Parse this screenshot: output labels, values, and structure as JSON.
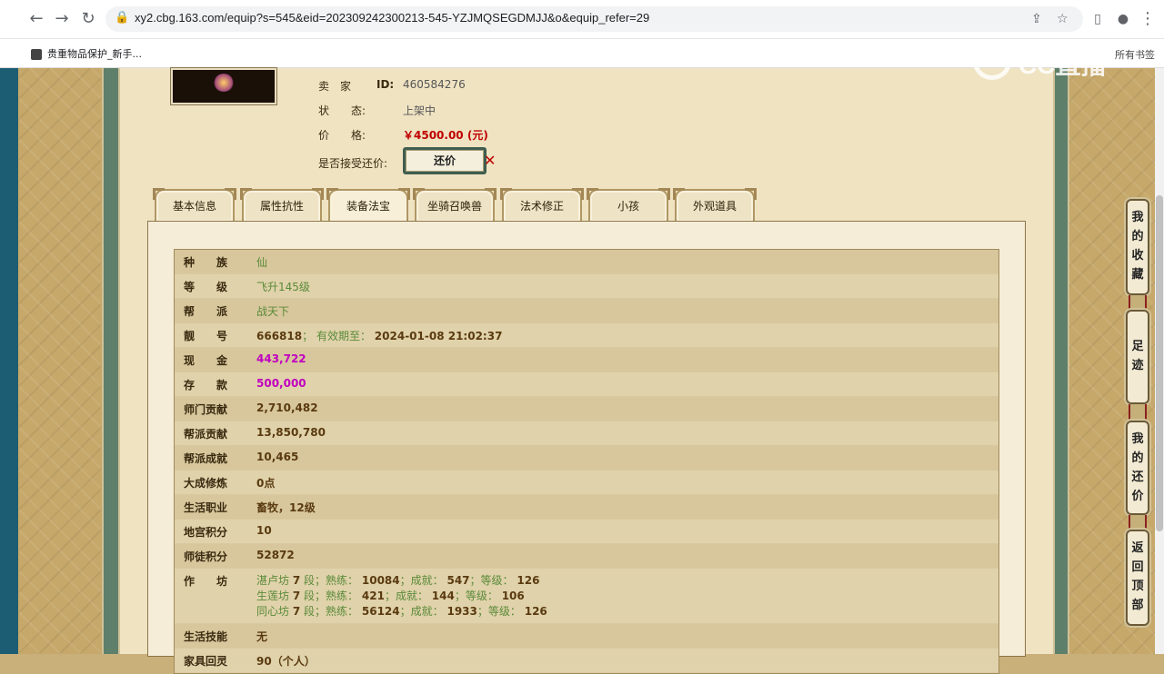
{
  "browser": {
    "url": "xy2.cbg.163.com/equip?s=545&eid=202309242300213-545-YZJMQSEGDMJJ&o&equip_refer=29",
    "bookmark": "贵重物品保护_新手...",
    "bookmarks_right": "所有书签",
    "watermark": "CC直播"
  },
  "listing": {
    "seller_label": "卖　家",
    "seller_key": "ID:",
    "seller_id": "460584276",
    "status_label": "状　　态:",
    "status_value": "上架中",
    "price_label": "价　　格:",
    "price_value": "￥4500.00 (元)",
    "counter_label": "是否接受还价:",
    "counter_button": "还价"
  },
  "tabs": [
    {
      "label": "基本信息"
    },
    {
      "label": "属性抗性"
    },
    {
      "label": "装备法宝"
    },
    {
      "label": "坐骑召唤兽"
    },
    {
      "label": "法术修正"
    },
    {
      "label": "小孩"
    },
    {
      "label": "外观道具"
    }
  ],
  "details": {
    "race_label": "种　　族",
    "race": "仙",
    "level_label": "等　　级",
    "level": "飞升145级",
    "faction_label": "帮　　派",
    "faction": "战天下",
    "number_label": "靓　　号",
    "number": "666818",
    "number_sep": "；",
    "valid_label": "有效期至：",
    "valid_date": "2024-01-08 21:02:37",
    "cash_label": "现　　金",
    "cash": "443,722",
    "deposit_label": "存　　款",
    "deposit": "500,000",
    "sect_contrib_label": "师门贡献",
    "sect_contrib": "2,710,482",
    "faction_contrib_label": "帮派贡献",
    "faction_contrib": "13,850,780",
    "faction_achieve_label": "帮派成就",
    "faction_achieve": "10,465",
    "cultivation_label": "大成修炼",
    "cultivation": "0点",
    "career_label": "生活职业",
    "career": "畜牧，12级",
    "palace_label": "地宫积分",
    "palace": "10",
    "mentor_label": "师徒积分",
    "mentor": "52872",
    "workshop_label": "作　　坊",
    "workshops": [
      {
        "name": "湛卢坊",
        "seg": "7",
        "seg_unit": "段；熟练：",
        "skill": "10084",
        "ach_label": "；成就：",
        "ach": "547",
        "lvl_label": "；等级：",
        "lvl": "126"
      },
      {
        "name": "生莲坊",
        "seg": "7",
        "seg_unit": "段；熟练：",
        "skill": "421",
        "ach_label": "；成就：",
        "ach": "144",
        "lvl_label": "；等级：",
        "lvl": "106"
      },
      {
        "name": "同心坊",
        "seg": "7",
        "seg_unit": "段；熟练：",
        "skill": "56124",
        "ach_label": "；成就：",
        "ach": "1933",
        "lvl_label": "；等级：",
        "lvl": "126"
      }
    ],
    "life_skill_label": "生活技能",
    "life_skill": "无",
    "furniture_label": "家具回灵",
    "furniture": "90（个人）"
  },
  "float_nav": {
    "favorites": [
      "我",
      "的",
      "收",
      "藏"
    ],
    "history": [
      "足",
      "迹"
    ],
    "my_offers": [
      "我",
      "的",
      "还",
      "价"
    ],
    "top": [
      "返",
      "回",
      "顶",
      "部"
    ]
  }
}
